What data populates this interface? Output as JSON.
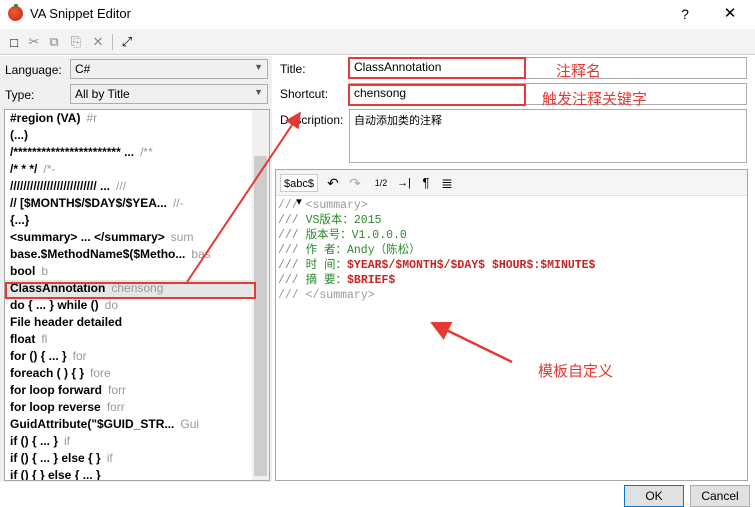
{
  "window": {
    "title": "VA Snippet Editor",
    "help": "?",
    "close": "✕"
  },
  "toolbar": {
    "buttons": [
      {
        "name": "new-icon",
        "glyph": "□"
      },
      {
        "name": "cut-icon",
        "glyph": "✂"
      },
      {
        "name": "copy-icon",
        "glyph": "⧉"
      },
      {
        "name": "paste-icon",
        "glyph": "⎘"
      },
      {
        "name": "delete-icon",
        "glyph": "✕"
      },
      {
        "name": "open-editor-icon",
        "glyph": "⤢"
      }
    ]
  },
  "filters": {
    "language_label": "Language:",
    "language_value": "C#",
    "type_label": "Type:",
    "type_value": "All by Title"
  },
  "snippets": [
    {
      "title": "#region (VA)",
      "shortcut": "#r"
    },
    {
      "title": "(...)",
      "shortcut": ""
    },
    {
      "title": "/*********************** ...",
      "shortcut": "/**"
    },
    {
      "title": "/* *   */",
      "shortcut": "/*-"
    },
    {
      "title": "////////////////////////// ...",
      "shortcut": "///"
    },
    {
      "title": "//   [$MONTH$/$DAY$/$YEA...",
      "shortcut": "//-"
    },
    {
      "title": "{...}",
      "shortcut": ""
    },
    {
      "title": "<summary> ... </summary>",
      "shortcut": "sum"
    },
    {
      "title": "base.$MethodName$($Metho...",
      "shortcut": "bas"
    },
    {
      "title": "bool",
      "shortcut": "b"
    },
    {
      "title": "ClassAnnotation",
      "shortcut": "chensong",
      "selected": true
    },
    {
      "title": "do { ... } while ()",
      "shortcut": "do"
    },
    {
      "title": "File header detailed",
      "shortcut": ""
    },
    {
      "title": "float",
      "shortcut": "fl"
    },
    {
      "title": "for () { ... }",
      "shortcut": "for"
    },
    {
      "title": "foreach ( ) { }",
      "shortcut": "fore"
    },
    {
      "title": "for loop forward",
      "shortcut": "forr"
    },
    {
      "title": "for loop reverse",
      "shortcut": "forr"
    },
    {
      "title": "GuidAttribute(\"$GUID_STR...",
      "shortcut": "Gui"
    },
    {
      "title": "if () { ... }",
      "shortcut": "if"
    },
    {
      "title": "if () { ... } else { }",
      "shortcut": "if"
    },
    {
      "title": "if () { } else { ... }",
      "shortcut": ""
    }
  ],
  "form": {
    "title_label": "Title:",
    "title_value": "ClassAnnotation",
    "shortcut_label": "Shortcut:",
    "shortcut_value": "chensong",
    "description_label": "Description:",
    "description_value": "自动添加类的注释"
  },
  "editor_toolbar": {
    "abc": "$abc$ ▾",
    "undo": "↶",
    "redo": "↷",
    "line_numbers": "1/2",
    "indent": "→|",
    "pilcrow": "¶",
    "align": "≣"
  },
  "code": {
    "l1": "/// <summary>",
    "l2a": "/// ",
    "l2b": "VS版本：2015",
    "l3a": "/// ",
    "l3b": "版本号：V1.0.0.0",
    "l4a": "/// ",
    "l4b": "作  者：Andy（陈松）",
    "l5a": "/// ",
    "l5b": "时  间：",
    "l5c": "$YEAR$/$MONTH$/$DAY$ $HOUR$:$MINUTE$",
    "l6a": "/// ",
    "l6b": "摘  要：",
    "l6c": "$BRIEF$",
    "l7": "/// </summary>"
  },
  "buttons": {
    "ok": "OK",
    "cancel": "Cancel"
  },
  "annotations": {
    "title_note": "注释名",
    "shortcut_note": "触发注释关键字",
    "template_note": "模板自定义",
    "color": "#e53935"
  }
}
